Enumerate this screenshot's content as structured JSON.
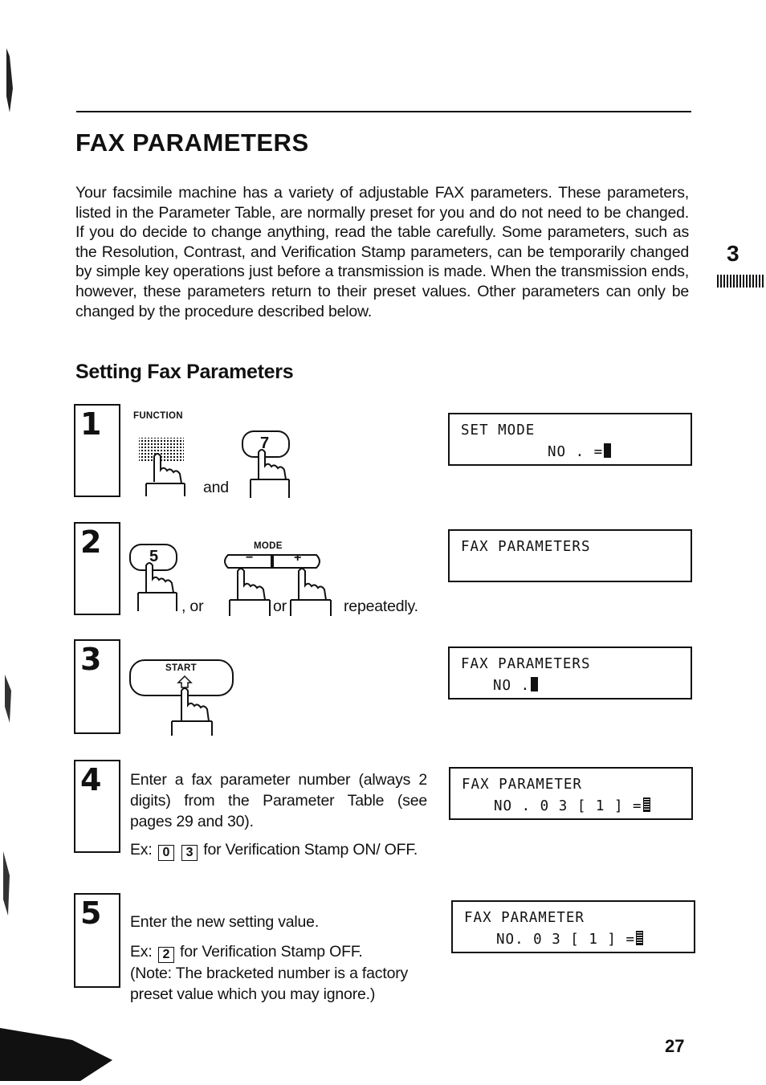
{
  "page": {
    "title": "FAX PARAMETERS",
    "intro": "Your facsimile machine has a variety of adjustable FAX parameters. These parameters, listed in the Parameter Table, are normally preset for you and do not need to be changed. If you do decide to change anything, read the table carefully. Some parameters, such as the Resolution, Contrast, and Verification Stamp parameters, can be temporarily changed by simple key operations just before a transmission is made. When the transmission ends, however, these parameters return to their preset values. Other parameters can only be changed by the procedure described below.",
    "chapter_number": "3",
    "section_title": "Setting Fax Parameters",
    "page_number": "27"
  },
  "steps": [
    {
      "number": "1",
      "key_label": "FUNCTION",
      "key_digit": "7",
      "connector": "and",
      "display": {
        "line1": "SET  MODE",
        "line2": "NO . ="
      }
    },
    {
      "number": "2",
      "key_digit": "5",
      "mode_label": "MODE",
      "minus": "−",
      "plus": "+",
      "or1": ", or",
      "or2": "or",
      "suffix": "repeatedly.",
      "display": {
        "line1": "FAX  PARAMETERS",
        "line2": ""
      }
    },
    {
      "number": "3",
      "key_label": "START",
      "display": {
        "line1": "FAX  PARAMETERS",
        "line2": "NO ."
      }
    },
    {
      "number": "4",
      "text": "Enter a fax parameter number (always 2 digits) from the Parameter Table (see pages 29 and 30).",
      "example_prefix": "Ex:",
      "example_keys": [
        "0",
        "3"
      ],
      "example_suffix": "for Verification Stamp ON/ OFF.",
      "display": {
        "line1": "FAX  PARAMETER",
        "line2": "NO . 0 3 [ 1 ] ="
      }
    },
    {
      "number": "5",
      "text": "Enter the new setting value.",
      "example_prefix": "Ex:",
      "example_keys": [
        "2"
      ],
      "example_suffix": "for Verification Stamp OFF.",
      "note": "(Note: The bracketed number is a factory preset value which you may ignore.)",
      "display": {
        "line1": "FAX  PARAMETER",
        "line2": "NO. 0 3 [ 1 ] ="
      }
    }
  ]
}
